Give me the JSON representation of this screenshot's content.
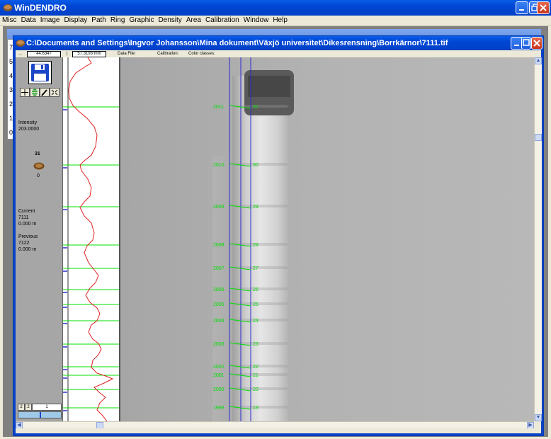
{
  "app": {
    "title": "WinDENDRO",
    "menu": [
      "Misc",
      "Data",
      "Image",
      "Display",
      "Path",
      "Ring",
      "Graphic",
      "Density",
      "Area",
      "Calibration",
      "Window",
      "Help"
    ]
  },
  "background_child": {
    "side_numbers": [
      "7",
      "5",
      "4",
      "3",
      "2",
      "1",
      "0"
    ]
  },
  "doc": {
    "title": "C:\\Documents and Settings\\Ingvor Johansson\\Mina dokument\\Växjö universitet\\Dikesrensning\\Borrkärnor\\7111.tif",
    "infobar": {
      "field1_prefix": "...",
      "field1": "44.6347",
      "field2": "57.3193 mm",
      "data_file_label": "Data File:",
      "calibration_label": "Calibration:",
      "color_classes_label": "Color classes:"
    },
    "panel": {
      "intensity_label": "Intensity",
      "intensity_value": "203.0000",
      "ring_count": "31",
      "ring_zero": "0",
      "current_label": "Current",
      "current_id": "7111",
      "current_pos": "0.000 m",
      "previous_label": "Previous",
      "previous_id": "7122",
      "previous_pos": "0.000 m",
      "bottom_field_a": "2",
      "bottom_field_b": "2",
      "bottom_field_c": "1"
    },
    "rings": [
      {
        "year": "2011",
        "index": "31"
      },
      {
        "year": "2010",
        "index": "30"
      },
      {
        "year": "2009",
        "index": "29"
      },
      {
        "year": "2008",
        "index": "28"
      },
      {
        "year": "2007",
        "index": "27"
      },
      {
        "year": "2006",
        "index": "26"
      },
      {
        "year": "2005",
        "index": "25"
      },
      {
        "year": "2004",
        "index": "24"
      },
      {
        "year": "2003",
        "index": "23"
      },
      {
        "year": "2002",
        "index": "22"
      },
      {
        "year": "2001",
        "index": "21"
      },
      {
        "year": "2000",
        "index": "20"
      },
      {
        "year": "1999",
        "index": "19"
      }
    ]
  },
  "colors": {
    "ring_line": "#00e000",
    "path_line": "#2a2ad0",
    "density_curve": "#e02020"
  }
}
